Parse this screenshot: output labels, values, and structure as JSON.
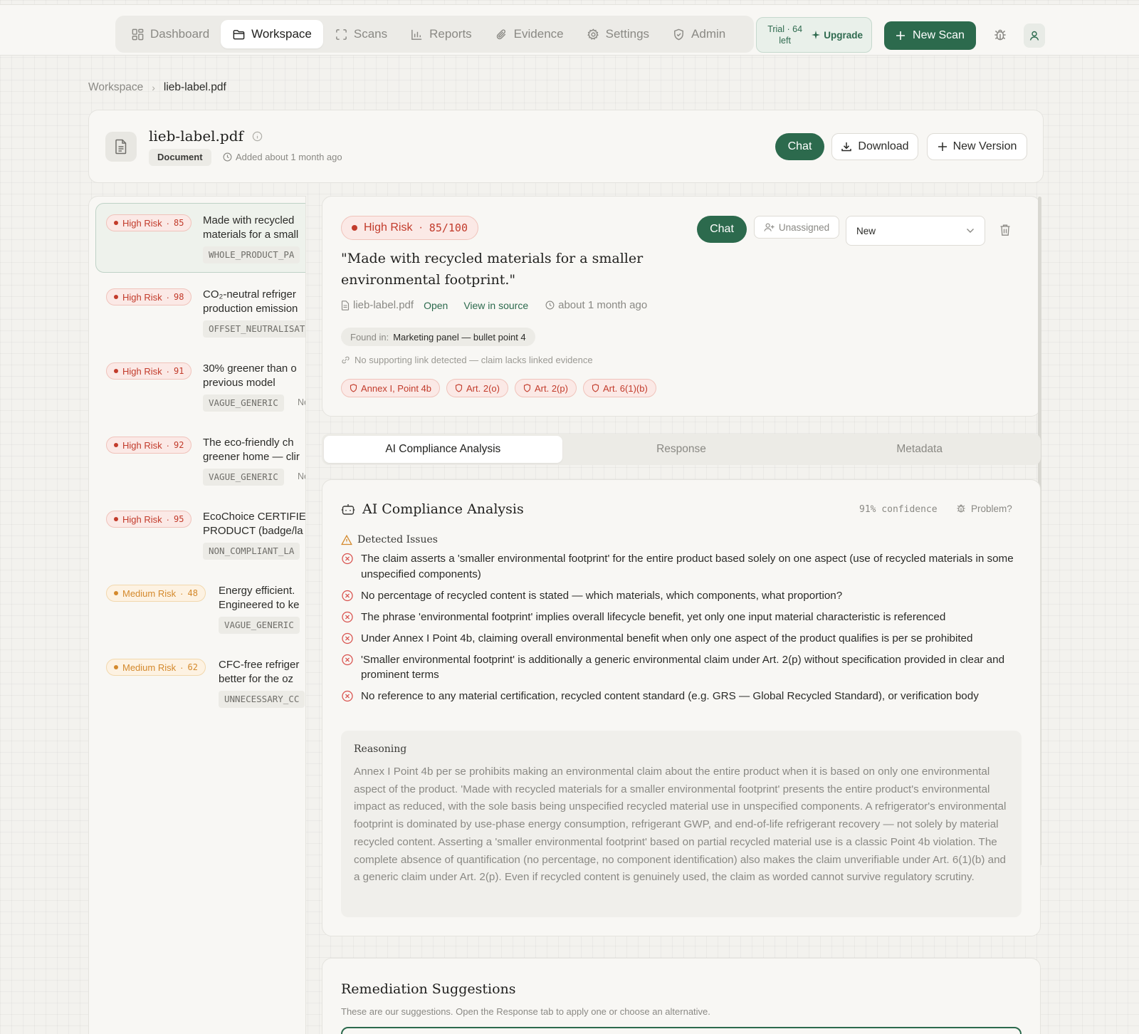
{
  "nav": {
    "items": [
      {
        "label": "Dashboard",
        "icon": "grid-icon"
      },
      {
        "label": "Workspace",
        "icon": "folder-icon",
        "active": true
      },
      {
        "label": "Scans",
        "icon": "scan-icon"
      },
      {
        "label": "Reports",
        "icon": "bar-chart-icon"
      },
      {
        "label": "Evidence",
        "icon": "paperclip-icon"
      },
      {
        "label": "Settings",
        "icon": "gear-icon"
      },
      {
        "label": "Admin",
        "icon": "shield-icon"
      }
    ],
    "trial_label": "Trial · 64 left",
    "upgrade_label": "Upgrade",
    "new_scan_label": "New Scan"
  },
  "breadcrumb": {
    "root": "Workspace",
    "current": "lieb-label.pdf"
  },
  "document": {
    "title": "lieb-label.pdf",
    "type_badge": "Document",
    "added": "Added about 1 month ago",
    "chat_label": "Chat",
    "download_label": "Download",
    "new_version_label": "New Version"
  },
  "claims": [
    {
      "risk": "High Risk",
      "level": "high",
      "score": "85",
      "line1": "Made with recycled",
      "line2": "materials for a small",
      "tag": "WHOLE_PRODUCT_PA",
      "status": "",
      "selected": true
    },
    {
      "risk": "High Risk",
      "level": "high",
      "score": "98",
      "line1": "CO₂-neutral refriger",
      "line2": "production emission",
      "tag": "OFFSET_NEUTRALISAT",
      "status": ""
    },
    {
      "risk": "High Risk",
      "level": "high",
      "score": "91",
      "line1": "30% greener than o",
      "line2": "previous model",
      "tag": "VAGUE_GENERIC",
      "status": "Ne"
    },
    {
      "risk": "High Risk",
      "level": "high",
      "score": "92",
      "line1": "The eco-friendly ch",
      "line2": "greener home — clir",
      "tag": "VAGUE_GENERIC",
      "status": "Ne"
    },
    {
      "risk": "High Risk",
      "level": "high",
      "score": "95",
      "line1": "EcoChoice CERTIFIE",
      "line2": "PRODUCT (badge/la",
      "tag": "NON_COMPLIANT_LA",
      "status": ""
    },
    {
      "risk": "Medium Risk",
      "level": "med",
      "score": "48",
      "line1": "Energy efficient.",
      "line2": "Engineered to ke",
      "tag": "VAGUE_GENERIC",
      "status": ""
    },
    {
      "risk": "Medium Risk",
      "level": "med",
      "score": "62",
      "line1": "CFC-free refriger",
      "line2": "better for the oz",
      "tag": "UNNECESSARY_CC",
      "status": ""
    }
  ],
  "detail": {
    "risk_label": "High Risk",
    "score": "85/100",
    "quote": "\"Made with recycled materials for a smaller environmental footprint.\"",
    "file": "lieb-label.pdf",
    "open_label": "Open",
    "view_source_label": "View in source",
    "time": "about 1 month ago",
    "found_prefix": "Found in:",
    "found_location": "Marketing panel — bullet point 4",
    "no_link": "No supporting link detected — claim lacks linked evidence",
    "refs": [
      "Annex I, Point 4b",
      "Art. 2(o)",
      "Art. 2(p)",
      "Art. 6(1)(b)"
    ],
    "chat_label": "Chat",
    "assignee": "Unassigned",
    "status": "New"
  },
  "tabs": [
    {
      "label": "AI Compliance Analysis",
      "active": true
    },
    {
      "label": "Response"
    },
    {
      "label": "Metadata"
    }
  ],
  "analysis": {
    "title": "AI Compliance Analysis",
    "confidence": "91% confidence",
    "problem_label": "Problem?",
    "issues_heading": "Detected Issues",
    "issues": [
      "The claim asserts a 'smaller environmental footprint' for the entire product based solely on one aspect (use of recycled materials in some unspecified components)",
      "No percentage of recycled content is stated — which materials, which components, what proportion?",
      "The phrase 'environmental footprint' implies overall lifecycle benefit, yet only one input material characteristic is referenced",
      "Under Annex I Point 4b, claiming overall environmental benefit when only one aspect of the product qualifies is per se prohibited",
      "'Smaller environmental footprint' is additionally a generic environmental claim under Art. 2(p) without specification provided in clear and prominent terms",
      "No reference to any material certification, recycled content standard (e.g. GRS — Global Recycled Standard), or verification body"
    ],
    "reasoning_heading": "Reasoning",
    "reasoning": "Annex I Point 4b per se prohibits making an environmental claim about the entire product when it is based on only one environmental aspect of the product. 'Made with recycled materials for a smaller environmental footprint' presents the entire product's environmental impact as reduced, with the sole basis being unspecified recycled material use in unspecified components. A refrigerator's environmental footprint is dominated by use-phase energy consumption, refrigerant GWP, and end-of-life refrigerant recovery — not solely by material recycled content. Asserting a 'smaller environmental footprint' based on partial recycled material use is a classic Point 4b violation. The complete absence of quantification (no percentage, no component identification) also makes the claim unverifiable under Art. 6(1)(b) and a generic claim under Art. 2(p). Even if recycled content is genuinely used, the claim as worded cannot survive regulatory scrutiny."
  },
  "remediation": {
    "title": "Remediation Suggestions",
    "subtitle": "These are our suggestions. Open the Response tab to apply one or choose an alternative."
  },
  "colors": {
    "accent": "#2c6a4d",
    "high_risk": "#c23b2b",
    "medium_risk": "#d4892c"
  }
}
